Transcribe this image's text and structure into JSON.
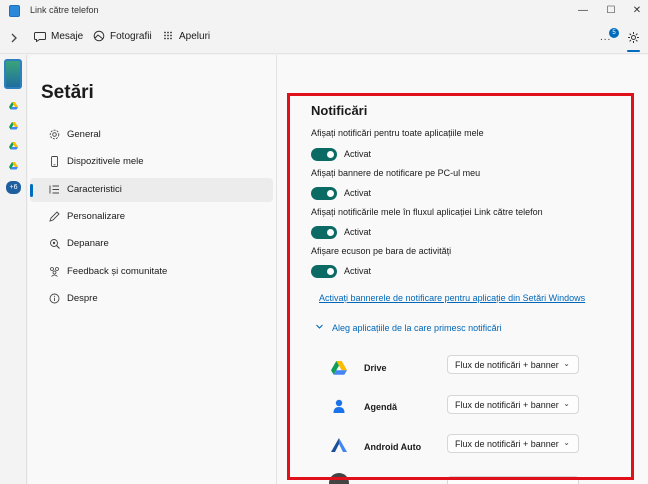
{
  "window": {
    "title": "Link către telefon",
    "controls": {
      "minimize": "—",
      "maximize": "☐",
      "close": "✕"
    }
  },
  "nav": {
    "tabs": [
      {
        "label": "Mesaje",
        "icon": "chat-bubble-icon"
      },
      {
        "label": "Fotografii",
        "icon": "photos-icon"
      },
      {
        "label": "Apeluri",
        "icon": "dialpad-icon"
      }
    ],
    "more_label": "...",
    "notification_badge": "5",
    "active_accent": "#006cbe"
  },
  "left_rail": {
    "more_apps": "+6",
    "app_icons": [
      "drive-icon",
      "drive-icon",
      "drive-icon",
      "drive-icon"
    ]
  },
  "settings": {
    "title": "Setări",
    "menu": [
      {
        "label": "General",
        "icon": "gear-icon",
        "active": false
      },
      {
        "label": "Dispozitivele mele",
        "icon": "phone-icon",
        "active": false
      },
      {
        "label": "Caracteristici",
        "icon": "list-icon",
        "active": true
      },
      {
        "label": "Personalizare",
        "icon": "pen-icon",
        "active": false
      },
      {
        "label": "Depanare",
        "icon": "troubleshoot-icon",
        "active": false
      },
      {
        "label": "Feedback și comunitate",
        "icon": "community-icon",
        "active": false
      },
      {
        "label": "Despre",
        "icon": "info-icon",
        "active": false
      }
    ]
  },
  "notifications": {
    "title": "Notificări",
    "options": [
      {
        "label": "Afișați notificări pentru toate aplicațiile mele",
        "state": "Activat",
        "on": true
      },
      {
        "label": "Afișați bannere de notificare pe PC-ul meu",
        "state": "Activat",
        "on": true
      },
      {
        "label": "Afișați notificările mele în fluxul aplicației Link către telefon",
        "state": "Activat",
        "on": true
      },
      {
        "label": "Afișare ecuson pe bara de activități",
        "state": "Activat",
        "on": true
      }
    ],
    "windows_link": "Activați bannerele de notificare pentru aplicație din Setări Windows",
    "expander_label": "Aleg aplicațiile de la care primesc notificări",
    "apps": [
      {
        "name": "Drive",
        "icon": "google-drive-icon",
        "setting": "Flux de notificări + banner"
      },
      {
        "name": "Agendă",
        "icon": "contacts-icon",
        "setting": "Flux de notificări + banner"
      },
      {
        "name": "Android Auto",
        "icon": "android-auto-icon",
        "setting": "Flux de notificări + banner"
      }
    ],
    "toggle_color": "#0b6b64",
    "highlight_color": "#e0111b"
  }
}
